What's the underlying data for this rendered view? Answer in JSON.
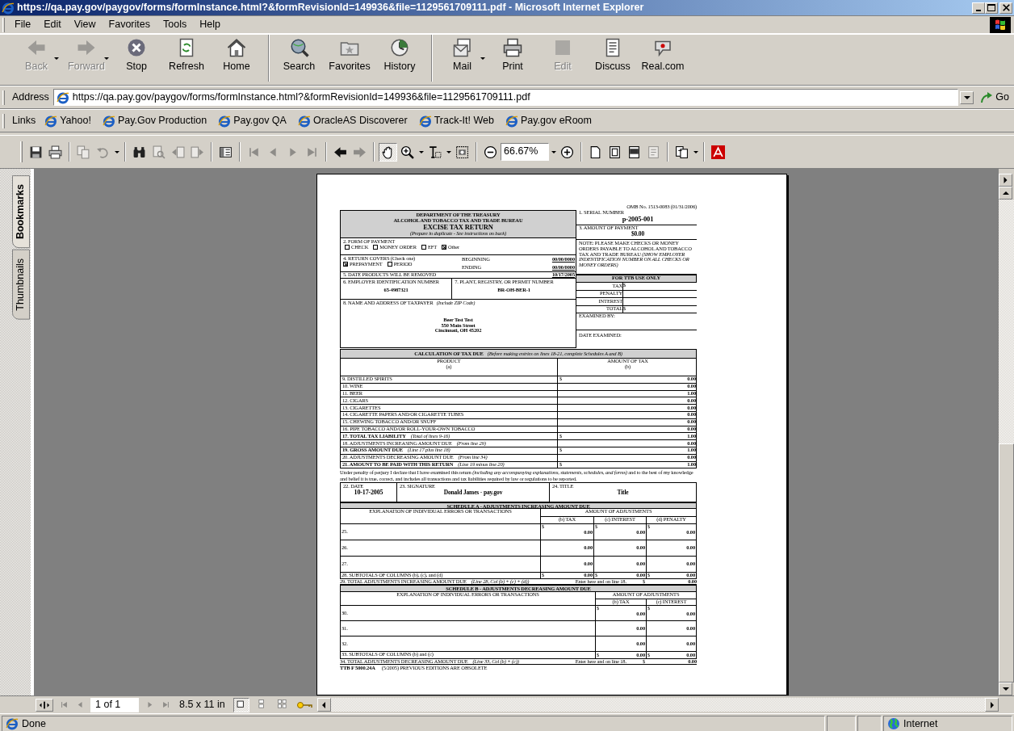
{
  "window": {
    "title": "https://qa.pay.gov/paygov/forms/formInstance.html?&formRevisionId=149936&file=1129561709111.pdf - Microsoft Internet Explorer"
  },
  "menu": [
    "File",
    "Edit",
    "View",
    "Favorites",
    "Tools",
    "Help"
  ],
  "toolbar": [
    {
      "label": "Back",
      "disabled": true,
      "dropdown": true,
      "separator_before": false
    },
    {
      "label": "Forward",
      "disabled": true,
      "dropdown": true,
      "separator_before": false
    },
    {
      "label": "Stop",
      "disabled": false,
      "dropdown": false,
      "separator_before": false
    },
    {
      "label": "Refresh",
      "disabled": false,
      "dropdown": false,
      "separator_before": false
    },
    {
      "label": "Home",
      "disabled": false,
      "dropdown": false,
      "separator_before": false
    },
    {
      "label": "Search",
      "disabled": false,
      "dropdown": false,
      "separator_before": true
    },
    {
      "label": "Favorites",
      "disabled": false,
      "dropdown": false,
      "separator_before": false
    },
    {
      "label": "History",
      "disabled": false,
      "dropdown": false,
      "separator_before": false
    },
    {
      "label": "Mail",
      "disabled": false,
      "dropdown": true,
      "separator_before": true
    },
    {
      "label": "Print",
      "disabled": false,
      "dropdown": false,
      "separator_before": false
    },
    {
      "label": "Edit",
      "disabled": true,
      "dropdown": false,
      "separator_before": false
    },
    {
      "label": "Discuss",
      "disabled": false,
      "dropdown": false,
      "separator_before": false
    },
    {
      "label": "Real.com",
      "disabled": false,
      "dropdown": false,
      "separator_before": false
    }
  ],
  "address": {
    "label": "Address",
    "url": "https://qa.pay.gov/paygov/forms/formInstance.html?&formRevisionId=149936&file=1129561709111.pdf",
    "go": "Go"
  },
  "links": {
    "label": "Links",
    "items": [
      "Yahoo!",
      "Pay.Gov Production",
      "Pay.gov QA",
      "OracleAS Discoverer",
      "Track-It! Web",
      "Pay.gov eRoom"
    ]
  },
  "reader_toolbar": {
    "zoom": "66.67%",
    "tools": [
      {
        "disabled": false,
        "pressed": false
      },
      {
        "disabled": false,
        "pressed": false
      },
      {
        "disabled": true,
        "pressed": false
      },
      {
        "disabled": true,
        "pressed": false
      },
      {
        "disabled": false,
        "pressed": false
      },
      {
        "disabled": true,
        "pressed": false
      },
      {
        "disabled": true,
        "pressed": false
      },
      {
        "disabled": true,
        "pressed": false
      },
      {
        "disabled": false,
        "pressed": false
      },
      {
        "disabled": true,
        "pressed": false
      },
      {
        "disabled": true,
        "pressed": false
      },
      {
        "disabled": true,
        "pressed": false
      },
      {
        "disabled": true,
        "pressed": false
      },
      {
        "disabled": false,
        "pressed": false
      },
      {
        "disabled": true,
        "pressed": false
      },
      {
        "disabled": false,
        "pressed": true
      },
      {
        "disabled": false,
        "pressed": false
      },
      {
        "disabled": false,
        "pressed": false
      },
      {
        "disabled": false,
        "pressed": false
      },
      {
        "disabled": false,
        "pressed": false
      },
      {
        "disabled": false,
        "pressed": false
      },
      {
        "disabled": false,
        "pressed": false
      },
      {
        "disabled": false,
        "pressed": false
      },
      {
        "disabled": false,
        "pressed": false
      },
      {
        "disabled": true,
        "pressed": false
      },
      {
        "disabled": false,
        "pressed": false
      },
      {
        "disabled": false,
        "pressed": false
      }
    ]
  },
  "side_tabs": [
    {
      "label": "Bookmarks",
      "selected": true
    },
    {
      "label": "Thumbnails",
      "selected": false
    }
  ],
  "document": {
    "omb": "OMB No. 1513-0083 (01/31/2006)",
    "header": {
      "dept": "DEPARTMENT OF THE TREASURY",
      "bureau": "ALCOHOL AND TOBACCO TAX AND TRADE BUREAU",
      "title": "EXCISE TAX RETURN",
      "subtitle": "(Prepare in duplicate - See instructions on back)"
    },
    "serial": {
      "label": "1. SERIAL NUMBER",
      "value": "p-2005-001"
    },
    "amount": {
      "label": "3. AMOUNT OF PAYMENT",
      "value": "$0.00"
    },
    "payment": {
      "label": "2. FORM OF PAYMENT",
      "options": [
        {
          "label": "CHECK",
          "checked": false
        },
        {
          "label": "MONEY ORDER",
          "checked": false
        },
        {
          "label": "EFT",
          "checked": false
        },
        {
          "label": "Other",
          "checked": true
        }
      ]
    },
    "note": "NOTE: PLEASE MAKE CHECKS OR MONEY ORDERS PAYABLE TO ALCOHOL AND TOBACCO TAX AND TRADE BUREAU *(SHOW EMPLOYER INDENTIFICATION NUMBER ON ALL CHECKS OR MONEY ORDERS)*",
    "covers": {
      "label": "4. RETURN COVERS (Check one)",
      "options": [
        {
          "label": "PREPAYMENT",
          "checked": true
        },
        {
          "label": "PERIOD",
          "checked": false
        }
      ],
      "beginning_label": "BEGINNING",
      "beginning": "00/00/0000",
      "ending_label": "ENDING",
      "ending": "00/00/0000"
    },
    "removal": {
      "label": "5. DATE PRODUCTS WILL BE REMOVED",
      "value": "10/17/2005"
    },
    "ttb": {
      "title": "FOR TTB USE ONLY",
      "rows": [
        {
          "label": "TAX",
          "value": "$"
        },
        {
          "label": "PENALTY"
        },
        {
          "label": "INTEREST"
        },
        {
          "label": "TOTAL",
          "value": "$"
        }
      ],
      "examined_by": "EXAMINED BY:",
      "date_examined": "DATE EXAMINED:"
    },
    "ein": {
      "label": "6. EMPLOYER IDENTIFICATION NUMBER",
      "value": "65-4987321"
    },
    "permit": {
      "label": "7. PLANT, REGISTRY, OR PERMIT NUMBER",
      "value": "BR-OH-BER-1"
    },
    "taxpayer": {
      "label": "8. NAME AND ADDRESS OF TAXPAYER",
      "note": "(Include ZIP Code)",
      "lines": [
        "Beer Test Test",
        "550 Main Street",
        "Cincinnati, OH  45202"
      ]
    },
    "calc": {
      "title": "CALCULATION OF TAX DUE",
      "note": "(Before making entries on lines 18-21, complete Schedules A and B)",
      "product": "PRODUCT",
      "product_sub": "(a)",
      "amount": "AMOUNT OF TAX",
      "amount_sub": "(b)",
      "rows": [
        {
          "label": "9. DISTILLED SPIRITS",
          "bold": false,
          "dollar": "$",
          "value": "0.00"
        },
        {
          "label": "10. WINE",
          "bold": false,
          "value": "0.00"
        },
        {
          "label": "11. BEER",
          "bold": false,
          "value": "1.00"
        },
        {
          "label": "12. CIGARS",
          "bold": false,
          "value": "0.00"
        },
        {
          "label": "13. CIGARETTES",
          "bold": false,
          "value": "0.00"
        },
        {
          "label": "14. CIGARETTE PAPERS AND/OR CIGARETTE TUBES",
          "bold": false,
          "value": "0.00"
        },
        {
          "label": "15. CHEWING TOBACCO AND/OR SNUFF",
          "bold": false,
          "value": "0.00"
        },
        {
          "label": "16. PIPE TOBACCO AND/OR ROLL-YOUR-OWN TOBACCO",
          "bold": false,
          "value": "0.00"
        },
        {
          "label": "17. TOTAL TAX LIABILITY",
          "note": "(Total of lines 9-16)",
          "bold": true,
          "dollar": "$",
          "value": "1.00"
        },
        {
          "label": "18. ADJUSTMENTS INCREASING AMOUNT DUE",
          "note": "(From line 29)",
          "bold": false,
          "value": "0.00"
        },
        {
          "label": "19. GROSS AMOUNT DUE",
          "note": "(Line 17 plus line 18)",
          "bold": true,
          "dollar": "$",
          "value": "1.00"
        },
        {
          "label": "20. ADJUSTMENTS DECREASING AMOUNT DUE",
          "note": "(From line 34)",
          "bold": false,
          "value": "0.00"
        },
        {
          "label": "21. AMOUNT TO BE PAID WITH THIS RETURN",
          "note": "(Line 19 minus line 20)",
          "bold": true,
          "dollar": "$",
          "value": "1.00"
        }
      ]
    },
    "certification": "Under penalty of perjury I declare that I have examined this return *(including any accompanying explanations, statements, schedules, and forms)* and to the best of my knowledge and belief it is true, correct, and includes all transactions and tax liabilities required by law or regulations to be reported.",
    "date": {
      "label": "22. DATE",
      "value": "10-17-2005"
    },
    "signature": {
      "label": "23. SIGNATURE",
      "value": "Donald  James - pay.gov"
    },
    "title_field": {
      "label": "24. TITLE",
      "value": "Title"
    },
    "schedules": [
      {
        "title": "SCHEDULE A - ADJUSTMENTS INCREASING AMOUNT DUE",
        "explanation": "EXPLANATION OF INDIVIDUAL ERRORS OR TRANSACTIONS",
        "amount_header": "AMOUNT OF ADJUSTMENTS",
        "columns": [
          "(b) TAX",
          "(c) INTEREST",
          "(d) PENALTY"
        ],
        "rows": [
          {
            "line": "25.",
            "dollar": "$",
            "values": [
              "0.00",
              "0.00",
              "0.00"
            ]
          },
          {
            "line": "26.",
            "values": [
              "0.00",
              "0.00",
              "0.00"
            ]
          },
          {
            "line": "27.",
            "values": [
              "0.00",
              "0.00",
              "0.00"
            ]
          }
        ],
        "subtotal": {
          "label": "28. SUBTOTALS OF COLUMNS (b), (c), and (d)",
          "dollar": "$",
          "values": [
            "0.00",
            "0.00",
            "0.00"
          ]
        },
        "total": {
          "label": "29. TOTAL ADJUSTMENTS INCREASING AMOUNT DUE",
          "note": "(Line 28, Col (b) + (c) + (d))",
          "enter": "Enter here and on line 18.",
          "dollar": "$",
          "value": "0.00"
        }
      },
      {
        "title": "SCHEDULE B - ADJUSTMENTS DECREASING AMOUNT DUE",
        "explanation": "EXPLANATION OF INDIVIDUAL ERRORS OR TRANSACTIONS",
        "amount_header": "AMOUNT OF ADJUSTMENTS",
        "columns": [
          "(b) TAX",
          "(c) INTEREST"
        ],
        "rows": [
          {
            "line": "30.",
            "dollar": "$",
            "values": [
              "0.00",
              "0.00"
            ]
          },
          {
            "line": "31.",
            "values": [
              "0.00",
              "0.00"
            ]
          },
          {
            "line": "32.",
            "values": [
              "0.00",
              "0.00"
            ]
          }
        ],
        "subtotal": {
          "label": "33. SUBTOTALS OF COLUMNS (b) and (c)",
          "dollar": "$",
          "values": [
            "0.00",
            "0.00"
          ]
        },
        "total": {
          "label": "34. TOTAL ADJUSTMENTS DECREASING AMOUNT DUE",
          "note": "(Line 33, Col (b) + (c))",
          "enter": "Enter here and on line 18.",
          "dollar": "$",
          "value": "0.00"
        }
      }
    ],
    "footer": {
      "form": "TTB F 5000.24A",
      "note": "(5/2005) PREVIOUS EDITIONS ARE OBSOLETE"
    }
  },
  "reader_status": {
    "page": "1 of 1",
    "size": "8.5 x 11 in",
    "layouts": [
      {
        "selected": true
      },
      {
        "selected": false
      },
      {
        "selected": false
      }
    ]
  },
  "status_bar": {
    "text": "Done",
    "zone": "Internet"
  }
}
